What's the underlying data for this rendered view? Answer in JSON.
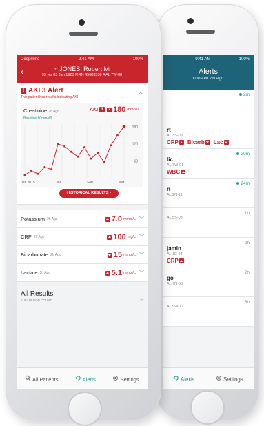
{
  "back_screen": {
    "status_left": "9:41 AM",
    "status_right": "100%",
    "header_title": "Alerts",
    "header_sub": "Updated 2m Ago",
    "rows": [
      {
        "name": "",
        "sub": "",
        "time": "2m",
        "teal": true,
        "tags": []
      },
      {
        "name": "rt",
        "sub": "AL 3S-09",
        "time": "",
        "teal": false,
        "tags": [
          {
            "label": "CRP",
            "dir": "up"
          },
          {
            "label": "Bicarb",
            "dir": "down"
          },
          {
            "label": "Lac",
            "dir": "up"
          }
        ]
      },
      {
        "name": "lic",
        "sub": "AL 7W-01",
        "time": "20m",
        "teal": true,
        "tags": [
          {
            "label": "WBC",
            "dir": "up"
          }
        ]
      },
      {
        "name": "n",
        "sub": "AL 2N-11",
        "time": "24m",
        "teal": true,
        "tags": []
      },
      {
        "name": "",
        "sub": "AL 5S-08",
        "time": "1h",
        "teal": false,
        "tags": []
      },
      {
        "name": "jamin",
        "sub": "AL 1E-24",
        "time": "2h",
        "teal": false,
        "tags": [
          {
            "label": "CRP",
            "dir": "up"
          }
        ]
      },
      {
        "name": "go",
        "sub": "AL 7N-03",
        "time": "2h",
        "teal": false,
        "tags": []
      },
      {
        "name": "",
        "sub": "AL 9W-12",
        "time": "3h",
        "teal": false,
        "tags": []
      }
    ],
    "tabs": {
      "alerts": "Alerts",
      "settings": "Settings"
    }
  },
  "front_screen": {
    "status_left": "Deepmind",
    "status_center": "9:41 AM",
    "status_right": "100%",
    "patient_name": "♂ JONES, Robert Mr",
    "patient_meta": "93 yrs 03 Jan 1923   MRN 45683338   RAL 7W-08",
    "alert_title": "AKI 3 Alert",
    "alert_sub": "This patient has results indicating AKI",
    "creatinine": {
      "label": "Creatinine",
      "age": "2h Ago",
      "aki_badge": "AKI",
      "aki_level": "3",
      "value": "180",
      "unit": "mmol/L",
      "baseline": "Baseline 60mmol/L"
    },
    "history_button": "HISTORICAL RESULTS ›",
    "results": [
      {
        "label": "Potassium",
        "age": "2h Ago",
        "value": "7.0",
        "unit": "mmol/L",
        "dir": "up"
      },
      {
        "label": "CRP",
        "age": "2h Ago",
        "value": "100",
        "unit": "mg/L",
        "dir": "up"
      },
      {
        "label": "Bicarbonate",
        "age": "2h Ago",
        "value": "15",
        "unit": "mmol/L",
        "dir": "down"
      },
      {
        "label": "Lactate",
        "age": "2h Ago",
        "value": "5.1",
        "unit": "mmol/L",
        "dir": "up"
      }
    ],
    "all_results": {
      "title": "All Results",
      "sub": "FULL BLOOD COUNT",
      "age": "2h"
    },
    "tabs": {
      "patients": "All Patients",
      "alerts": "Alerts",
      "settings": "Settings"
    }
  },
  "chart_data": {
    "type": "line",
    "title": "",
    "xlabel": "",
    "ylabel": "",
    "x_tick_labels": [
      "Dec 2015",
      "Jan",
      "Feb",
      "Mar"
    ],
    "y_tick_labels": [
      "180",
      "120",
      "60"
    ],
    "ylim": [
      0,
      190
    ],
    "baseline": 60,
    "series": [
      {
        "values": [
          10,
          25,
          14,
          38,
          30,
          120,
          112,
          92,
          75,
          108,
          68,
          88,
          55,
          115,
          150,
          182
        ]
      }
    ]
  },
  "colors": {
    "red": "#c9252d",
    "teal": "#2a9b8e",
    "blue_chevron": "#3e8ec6",
    "back_header": "#1e6478"
  }
}
